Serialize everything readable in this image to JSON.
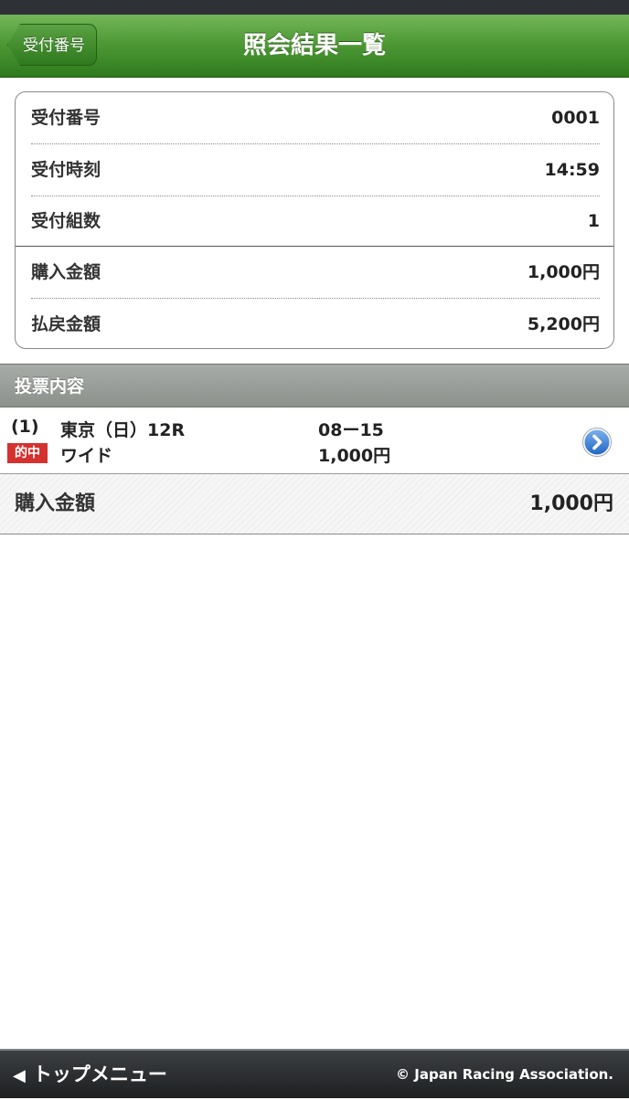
{
  "navbar": {
    "back_label": "受付番号",
    "title": "照会結果一覧"
  },
  "summary": {
    "rows": [
      {
        "label": "受付番号",
        "value": "0001"
      },
      {
        "label": "受付時刻",
        "value": "14:59"
      },
      {
        "label": "受付組数",
        "value": "1"
      },
      {
        "label": "購入金額",
        "value": "1,000円"
      },
      {
        "label": "払戻金額",
        "value": "5,200円"
      }
    ]
  },
  "votes": {
    "header": "投票内容",
    "items": [
      {
        "number": "(1)",
        "race": "東京（日）12R",
        "combination": "08ー15",
        "badge": "的中",
        "bet_type": "ワイド",
        "amount": "1,000円",
        "icon": "chevron-right-icon"
      }
    ]
  },
  "total": {
    "label": "購入金額",
    "value": "1,000円"
  },
  "footer": {
    "menu_label": "トップメニュー",
    "menu_icon": "triangle-left-icon",
    "copyright": "© Japan Racing Association."
  },
  "colors": {
    "nav_green": "#4f9a36",
    "hit_red": "#d5312f",
    "section_gray": "#9a9e9a",
    "footer_dark": "#2a2c2e",
    "detail_blue": "#2f7fd9"
  }
}
